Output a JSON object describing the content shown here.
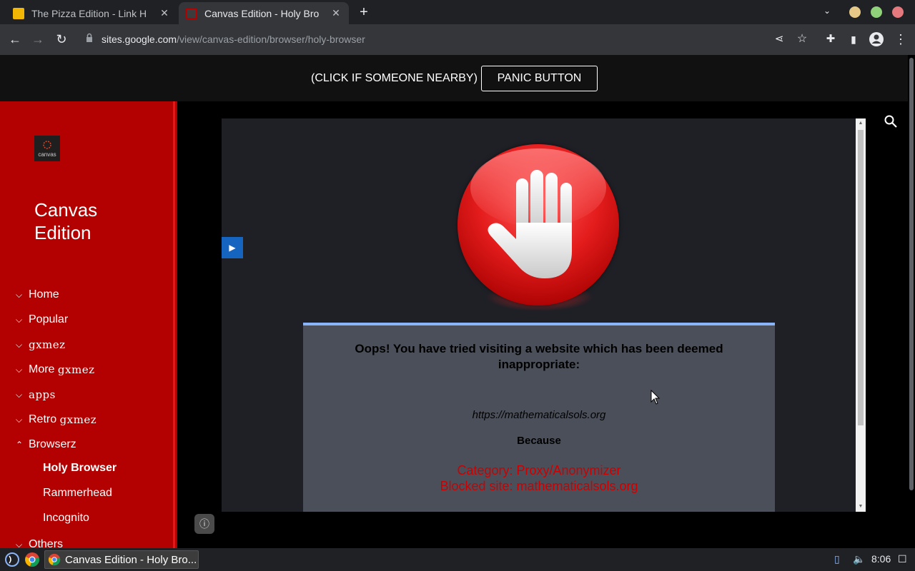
{
  "tabs": [
    {
      "title": "The Pizza Edition - Link H",
      "favicon_color": "#f2b705"
    },
    {
      "title": "Canvas Edition - Holy Bro",
      "favicon_color": "#3c3c3c"
    }
  ],
  "toolbar": {
    "url_host": "sites.google.com",
    "url_path": "/view/canvas-edition/browser/holy-browser"
  },
  "topbar": {
    "panic_label": "(CLICK IF SOMEONE NEARBY)",
    "panic_button": "PANIC BUTTON"
  },
  "sidebar": {
    "logo_text": "canvas",
    "site_title": "Canvas Edition",
    "nav": [
      {
        "label": "Home",
        "expanded": false
      },
      {
        "label": "Popular",
        "expanded": false
      },
      {
        "label": "gxmez",
        "expanded": false
      },
      {
        "label": "More ",
        "suffix": "gxmez",
        "expanded": false
      },
      {
        "label": "apps",
        "expanded": false
      },
      {
        "label": "Retro ",
        "suffix": "gxmez",
        "expanded": false
      },
      {
        "label": "Browserz",
        "expanded": true
      },
      {
        "label": "Others",
        "expanded": false
      }
    ],
    "sub": [
      {
        "label": "Holy Browser",
        "active": true
      },
      {
        "label": "Rammerhead",
        "active": false
      },
      {
        "label": "Incognito",
        "active": false
      }
    ]
  },
  "blocked": {
    "title": "Oops! You have tried visiting a website which has been deemed inappropriate:",
    "url": "https://mathematicalsols.org",
    "because": "Because",
    "category": "Category: Proxy/Anonymizer",
    "blocked_site": "Blocked site: mathematicalsols.org"
  },
  "taskbar": {
    "window_title": "Canvas Edition - Holy Bro...",
    "time": "8:06"
  },
  "colors": {
    "sidebar": "#b30000",
    "accent_link": "#8ab4f8",
    "error": "#cc0000"
  }
}
